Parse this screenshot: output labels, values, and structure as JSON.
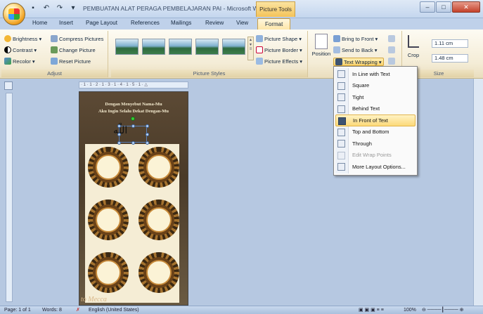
{
  "window": {
    "title": "PEMBUATAN ALAT PERAGA PEMBELAJARAN PAI - Microsoft Wo...",
    "context_tab": "Picture Tools",
    "min": "–",
    "max": "□",
    "close": "✕"
  },
  "tabs": [
    "Home",
    "Insert",
    "Page Layout",
    "References",
    "Mailings",
    "Review",
    "View",
    "Format"
  ],
  "ribbon": {
    "adjust": {
      "label": "Adjust",
      "brightness": "Brightness ▾",
      "contrast": "Contrast ▾",
      "recolor": "Recolor ▾",
      "compress": "Compress Pictures",
      "change": "Change Picture",
      "reset": "Reset Picture"
    },
    "styles": {
      "label": "Picture Styles",
      "shape": "Picture Shape ▾",
      "border": "Picture Border ▾",
      "effects": "Picture Effects ▾"
    },
    "arrange": {
      "position": "Position",
      "bring_front": "Bring to Front ▾",
      "send_back": "Send to Back ▾",
      "text_wrapping": "Text Wrapping ▾"
    },
    "size": {
      "label": "Size",
      "crop": "Crop",
      "height": "1.11 cm",
      "width": "1.48 cm"
    }
  },
  "document": {
    "ruler_text": "· 1 · 1 · 2 · 1 · 3 · 1 · 4 · 1 · 5 · 1 · △",
    "heading_line1": "Dengan Menyebut Nama-Mu",
    "heading_line2": "Aku Ingin Selalu Dekat Dengan-Mu",
    "calligraphy": "اللّٰه",
    "footer_script": "to Mecca"
  },
  "wrap_menu": {
    "items": [
      {
        "label": "In Line with Text",
        "state": "normal"
      },
      {
        "label": "Square",
        "state": "normal"
      },
      {
        "label": "Tight",
        "state": "normal"
      },
      {
        "label": "Behind Text",
        "state": "normal"
      },
      {
        "label": "In Front of Text",
        "state": "active"
      },
      {
        "label": "Top and Bottom",
        "state": "normal"
      },
      {
        "label": "Through",
        "state": "normal"
      },
      {
        "label": "Edit Wrap Points",
        "state": "disabled"
      },
      {
        "label": "More Layout Options...",
        "state": "normal"
      }
    ]
  },
  "status": {
    "page": "Page: 1 of 1",
    "words": "Words: 8",
    "language": "English (United States)",
    "zoom": "100%"
  }
}
